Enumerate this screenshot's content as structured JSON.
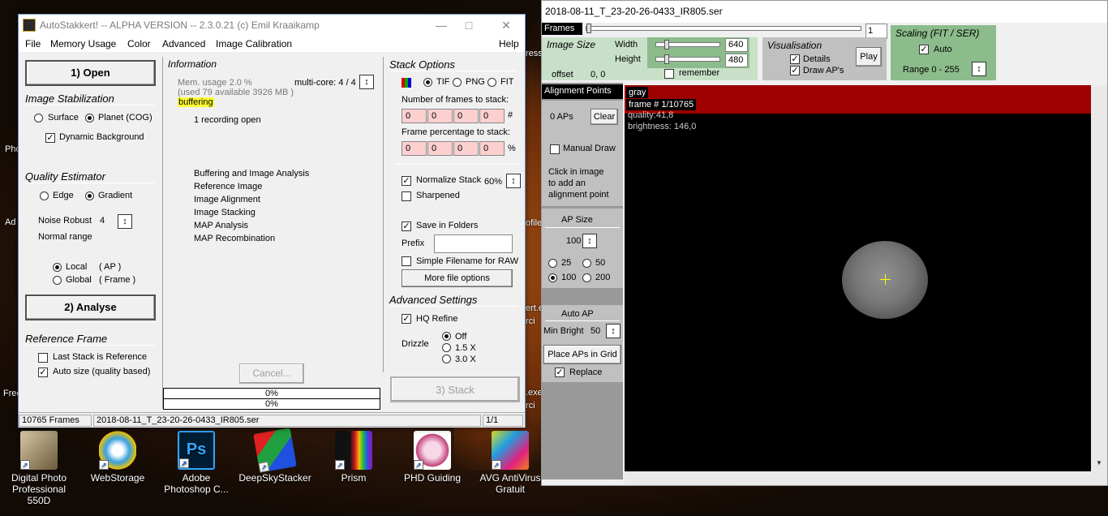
{
  "desktop": {
    "fragments": [
      "Pho",
      "Ad",
      "Free",
      "ress",
      "ofile",
      "ert.ex",
      "rci",
      ".exe",
      "rci"
    ],
    "icons": [
      {
        "label_line1": "Digital Photo",
        "label_line2": "Professional 550D",
        "icon": "photo-app-icon"
      },
      {
        "label_line1": "WebStorage",
        "label_line2": "",
        "icon": "webstorage-icon"
      },
      {
        "label_line1": "Adobe",
        "label_line2": "Photoshop C...",
        "icon": "photoshop-icon"
      },
      {
        "label_line1": "DeepSkyStacker",
        "label_line2": "",
        "icon": "deepskystacker-icon"
      },
      {
        "label_line1": "Prism",
        "label_line2": "",
        "icon": "prism-icon"
      },
      {
        "label_line1": "PHD Guiding",
        "label_line2": "",
        "icon": "phd-guiding-icon"
      },
      {
        "label_line1": "AVG AntiVirus",
        "label_line2": "Gratuit",
        "icon": "avg-antivirus-icon"
      }
    ]
  },
  "as": {
    "title": "AutoStakkert! -- ALPHA VERSION -- 2.3.0.21  (c) Emil Kraaikamp",
    "menu": [
      "File",
      "Memory Usage",
      "Color",
      "Advanced",
      "Image Calibration",
      "Help"
    ],
    "open_btn": "1) Open",
    "image_stab": {
      "title": "Image Stabilization",
      "surface": "Surface",
      "planet": "Planet (COG)",
      "dynamic_bg": "Dynamic Background"
    },
    "quality": {
      "title": "Quality Estimator",
      "edge": "Edge",
      "gradient": "Gradient",
      "noise_label": "Noise Robust",
      "noise_value": "4",
      "normal_range": "Normal range",
      "local": "Local",
      "local_tag": "( AP )",
      "global": "Global",
      "global_tag": "( Frame )"
    },
    "analyse_btn": "2) Analyse",
    "reference": {
      "title": "Reference Frame",
      "last_stack": "Last Stack is Reference",
      "auto_size": "Auto size (quality based)"
    },
    "info": {
      "title": "Information",
      "mem": "Mem. usage 2.0 %",
      "mem2": "(used 79 available 3926 MB )",
      "multicore": "multi-core: 4 / 4",
      "buffering": "buffering",
      "recording": "1 recording open",
      "steps": [
        "Buffering and Image Analysis",
        "Reference Image",
        "Image Alignment",
        "Image Stacking",
        "MAP Analysis",
        "MAP Recombination"
      ]
    },
    "cancel_btn": "Cancel...",
    "progress1": "0%",
    "progress2": "0%",
    "stack": {
      "title": "Stack Options",
      "tif": "TIF",
      "png": "PNG",
      "fit": "FIT",
      "num_frames_label": "Number of frames to stack:",
      "num_frames": [
        "0",
        "0",
        "0",
        "0"
      ],
      "num_suffix": "#",
      "pct_label": "Frame percentage to stack:",
      "pct": [
        "0",
        "0",
        "0",
        "0"
      ],
      "pct_suffix": "%",
      "normalize": "Normalize Stack",
      "normalize_val": "60%",
      "sharpened": "Sharpened",
      "save_folders": "Save in Folders",
      "prefix": "Prefix",
      "prefix_value": "",
      "simple_filename": "Simple Filename for RAW",
      "more_btn": "More file options"
    },
    "advanced": {
      "title": "Advanced Settings",
      "hq": "HQ Refine",
      "drizzle": "Drizzle",
      "off": "Off",
      "x15": "1.5 X",
      "x30": "3.0 X"
    },
    "stack_btn": "3) Stack",
    "status": {
      "frames": "10765 Frames",
      "file": "2018-08-11_T_23-20-26-0433_IR805.ser",
      "page": "1/1"
    }
  },
  "viewer": {
    "title": "2018-08-11_T_23-20-26-0433_IR805.ser",
    "frames_label": "Frames",
    "frame_value": "1",
    "image_size": {
      "title": "Image Size",
      "width_label": "Width",
      "width": "640",
      "height_label": "Height",
      "height": "480",
      "remember": "remember",
      "offset_label": "offset",
      "offset": "0, 0"
    },
    "visual": {
      "title": "Visualisation",
      "details": "Details",
      "draw_aps": "Draw AP's",
      "play": "Play"
    },
    "scaling": {
      "title": "Scaling (FIT / SER)",
      "auto": "Auto",
      "range": "Range 0 - 255"
    },
    "ap": {
      "title": "Alignment Points",
      "count": "0 APs",
      "clear": "Clear",
      "manual": "Manual Draw",
      "hint1": "Click in image",
      "hint2": "to add an",
      "hint3": "alignment point",
      "size_title": "AP Size",
      "size_value": "100",
      "s25": "25",
      "s50": "50",
      "s100": "100",
      "s200": "200",
      "auto_title": "Auto AP",
      "min_bright_label": "Min Bright",
      "min_bright": "50",
      "place_btn": "Place APs in Grid",
      "replace": "Replace"
    },
    "overlay": {
      "line1": "gray",
      "line2": "frame # 1/10765",
      "line3": "quality:41,8",
      "line4": "brightness: 146,0"
    }
  }
}
